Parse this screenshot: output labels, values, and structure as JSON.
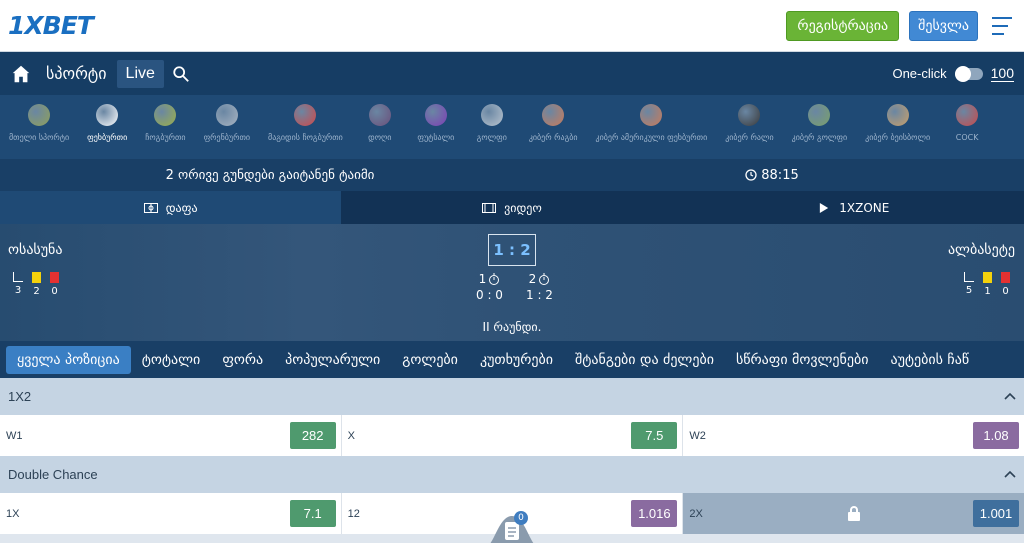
{
  "header": {
    "logo": "1XBET",
    "register_label": "რეგისტრაცია",
    "login_label": "შესვლა"
  },
  "nav": {
    "sports_label": "სპორტი",
    "live_label": "Live",
    "oneclick_label": "One-click",
    "oneclick_amount": "100"
  },
  "sports": [
    {
      "label": "მთელი სპორტი",
      "icon": "all-sports-icon",
      "color": "#8fa05a"
    },
    {
      "label": "ფეხბურთი",
      "icon": "football-icon",
      "color": "#ffffff"
    },
    {
      "label": "ჩოგბურთი",
      "icon": "tennis-icon",
      "color": "#9cb04a"
    },
    {
      "label": "ფრენბურთი",
      "icon": "volleyball-icon",
      "color": "#a9b5c2"
    },
    {
      "label": "მაგიდის ჩოგბურთი",
      "icon": "table-tennis-icon",
      "color": "#d04848"
    },
    {
      "label": "დოღი",
      "icon": "horse-racing-icon",
      "color": "#6b4f7a"
    },
    {
      "label": "ფუტსალი",
      "icon": "futsal-icon",
      "color": "#7d3fb5"
    },
    {
      "label": "გოლფი",
      "icon": "golf-icon",
      "color": "#b9c4cf"
    },
    {
      "label": "კიბერ რაგბი",
      "icon": "cyber-rugby-icon",
      "color": "#c97b5a"
    },
    {
      "label": "კიბერ ამერიკული ფეხბურთი",
      "icon": "cyber-american-football-icon",
      "color": "#c97b5a"
    },
    {
      "label": "კიბერ რალი",
      "icon": "cyber-rally-icon",
      "color": "#3a3a3a"
    },
    {
      "label": "კიბერ გოლფი",
      "icon": "cyber-golf-icon",
      "color": "#7aa06a"
    },
    {
      "label": "კიბერ ბეისბოლი",
      "icon": "cyber-baseball-icon",
      "color": "#c9a06a"
    },
    {
      "label": "COCK",
      "icon": "cockfight-icon",
      "color": "#c94a4a"
    }
  ],
  "match": {
    "info": "2 ორივე გუნდები გაიტანენ ტაიმი",
    "time": "88:15",
    "home": "ოსასუნა",
    "away": "ალბასეტე",
    "score": "1 : 2",
    "round": "II რაუნდი.",
    "home_stats": {
      "corners": "3",
      "yellow": "2",
      "red": "0"
    },
    "away_stats": {
      "corners": "5",
      "yellow": "1",
      "red": "0"
    },
    "half1": {
      "label": "1",
      "score": "0 : 0"
    },
    "half2": {
      "label": "2",
      "score": "1 : 2"
    }
  },
  "media_tabs": [
    {
      "label": "დაფა",
      "icon": "board-icon"
    },
    {
      "label": "ვიდეო",
      "icon": "video-icon"
    },
    {
      "label": "1XZONE",
      "icon": "play-icon"
    }
  ],
  "market_tabs": [
    "ყველა პოზიცია",
    "ტოტალი",
    "ფორა",
    "პოპულარული",
    "გოლები",
    "კუთხურები",
    "შტანგები და ძელები",
    "სწრაფი მოვლენები",
    "აუტების ჩაწ"
  ],
  "markets": [
    {
      "title": "1X2",
      "outcomes": [
        {
          "name": "W1",
          "odd": "282",
          "style": "green"
        },
        {
          "name": "X",
          "odd": "7.5",
          "style": "green"
        },
        {
          "name": "W2",
          "odd": "1.08",
          "style": "purple"
        }
      ]
    },
    {
      "title": "Double Chance",
      "outcomes": [
        {
          "name": "1X",
          "odd": "7.1",
          "style": "green"
        },
        {
          "name": "12",
          "odd": "1.016",
          "style": "purple"
        },
        {
          "name": "2X",
          "odd": "1.001",
          "style": "blue",
          "locked": true
        }
      ]
    }
  ],
  "coupon": {
    "count": "0"
  },
  "colors": {
    "brand": "#1a6fc1",
    "nav": "#163d64",
    "register": "#6ab436",
    "login": "#4189d4"
  }
}
